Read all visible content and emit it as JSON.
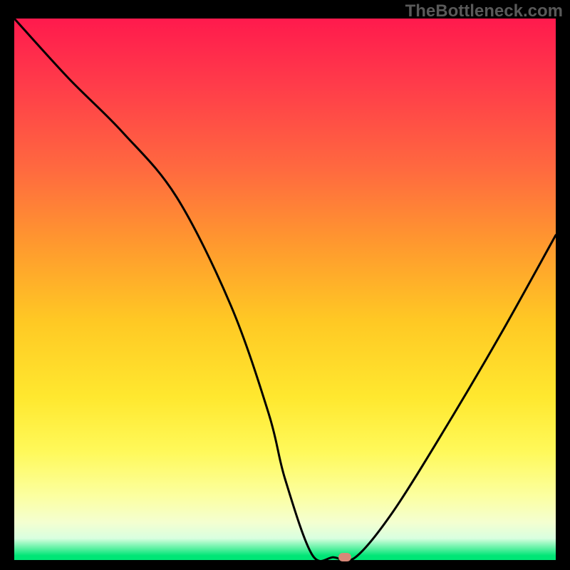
{
  "watermark": "TheBottleneck.com",
  "chart_data": {
    "type": "line",
    "title": "",
    "xlabel": "",
    "ylabel": "",
    "xlim": [
      0,
      100
    ],
    "ylim": [
      0,
      100
    ],
    "series": [
      {
        "name": "curve",
        "x": [
          0,
          10,
          20,
          30,
          40,
          47,
          50,
          55,
          59,
          63,
          70,
          80,
          90,
          100
        ],
        "values": [
          100,
          89,
          79,
          67,
          47,
          27,
          15,
          1,
          0.5,
          0.5,
          9,
          25,
          42,
          60
        ]
      }
    ],
    "marker": {
      "x": 61,
      "y": 0.5
    },
    "gradient_stops": [
      {
        "pos": 0,
        "color": "#ff1a4d"
      },
      {
        "pos": 0.12,
        "color": "#ff3b4a"
      },
      {
        "pos": 0.28,
        "color": "#ff6a3f"
      },
      {
        "pos": 0.42,
        "color": "#ff9a2e"
      },
      {
        "pos": 0.56,
        "color": "#ffc924"
      },
      {
        "pos": 0.7,
        "color": "#ffe82f"
      },
      {
        "pos": 0.8,
        "color": "#fff95a"
      },
      {
        "pos": 0.88,
        "color": "#fcff9f"
      },
      {
        "pos": 0.93,
        "color": "#f4ffd0"
      },
      {
        "pos": 0.96,
        "color": "#d9ffe0"
      },
      {
        "pos": 0.992,
        "color": "#00e676"
      },
      {
        "pos": 1.0,
        "color": "#00e676"
      }
    ]
  }
}
